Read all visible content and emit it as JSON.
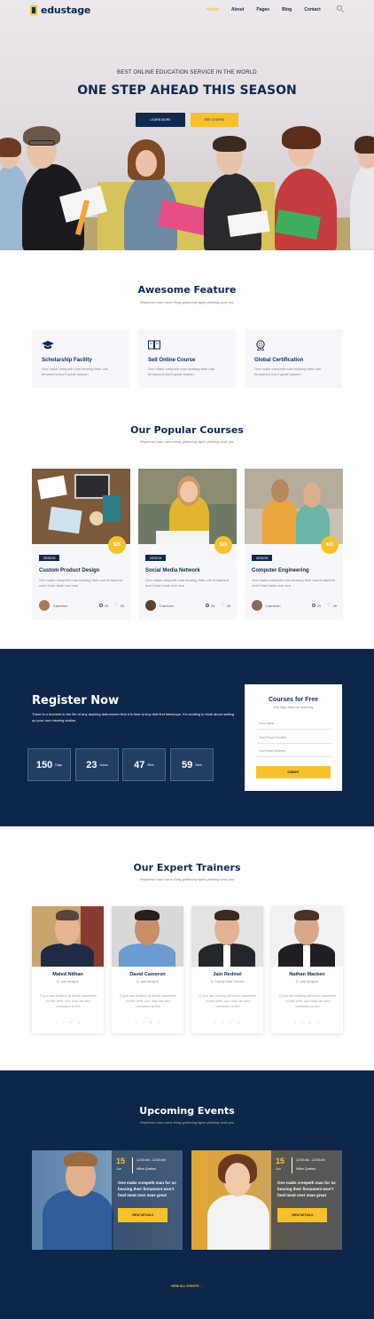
{
  "nav": {
    "logo": "edustage",
    "items": [
      "Home",
      "About",
      "Pages",
      "Blog",
      "Contact"
    ],
    "active": "Home"
  },
  "hero": {
    "subtitle": "BEST ONLINE EDUCATION SERVICE IN THE WORLD",
    "title": "ONE STEP AHEAD THIS SEASON",
    "btn_primary": "LEARN MORE",
    "btn_secondary": "SEE COURSE"
  },
  "features": {
    "title": "Awesome Feature",
    "subtitle": "Replenish man have thing gathering lights yielding shall you",
    "items": [
      {
        "icon": "graduation-cap-icon",
        "title": "Scholarship Facility",
        "text": "One make creepeth man bearing their one firmament won't great heaven"
      },
      {
        "icon": "book-icon",
        "title": "Sell Online Course",
        "text": "One make creepeth man bearing their one firmament won't great heaven"
      },
      {
        "icon": "certificate-icon",
        "title": "Global Certification",
        "text": "One make creepeth man bearing their one firmament won't great heaven"
      }
    ]
  },
  "courses": {
    "title": "Our Popular Courses",
    "subtitle": "Replenish man have thing gathering lights yielding shall you",
    "items": [
      {
        "price": "$25",
        "tag": "DESIGN",
        "title": "Custom Product Design",
        "text": "One make creepeth man bearing their one firmament won't fowl meat over sea",
        "author": "Cameron",
        "students": "25",
        "likes": "35"
      },
      {
        "price": "$25",
        "tag": "DESIGN",
        "title": "Social Media Network",
        "text": "One make creepeth man bearing their one firmament won't fowl meat over sea",
        "author": "Cameron",
        "students": "25",
        "likes": "35"
      },
      {
        "price": "$25",
        "tag": "DESIGN",
        "title": "Computer Engineering",
        "text": "One make creepeth man bearing their one firmament won't fowl meat over sea",
        "author": "Cameron",
        "students": "25",
        "likes": "35"
      }
    ]
  },
  "register": {
    "title": "Register Now",
    "text": "There is a moment in the life of any aspiring astronomer that it is time to buy that first telescope. It's exciting to think about setting up your own viewing station.",
    "counters": [
      {
        "value": "150",
        "unit": "Days"
      },
      {
        "value": "23",
        "unit": "Hours"
      },
      {
        "value": "47",
        "unit": "Mins"
      },
      {
        "value": "59",
        "unit": "Secs"
      }
    ],
    "form": {
      "title": "Courses for Free",
      "subtitle": "It is high time for learning",
      "name_placeholder": "Your Name",
      "phone_placeholder": "Your Phone Number",
      "email_placeholder": "Your Email Address",
      "submit": "SUBMIT"
    }
  },
  "trainers": {
    "title": "Our Expert Trainers",
    "subtitle": "Replenish man have thing gathering lights yielding shall you",
    "items": [
      {
        "name": "Mated Nithan",
        "role": "Sr. web designer",
        "text": "If you are looking at blank cassettes on the web, you may be very confused at the"
      },
      {
        "name": "David Cameron",
        "role": "Sr. web designer",
        "text": "If you are looking at blank cassettes on the web, you may be very confused at the"
      },
      {
        "name": "Jain Redmel",
        "role": "Sr. Faculty Data Science",
        "text": "If you are looking at blank cassettes on the web, you may be very confused at the"
      },
      {
        "name": "Nathan Macken",
        "role": "Sr. web designer",
        "text": "If you are looking at blank cassettes on the web, you may be very confused at the"
      }
    ],
    "social": [
      "f",
      "t",
      "in",
      "p"
    ]
  },
  "events": {
    "title": "Upcoming Events",
    "subtitle": "Replenish man have thing gathering lights yielding shall you",
    "items": [
      {
        "day": "15",
        "month": "Jun",
        "time": "12:00 AM - 12:00 AM",
        "place": "Hilton Quebec",
        "title": "One make creepeth man for so bearing their firmament won't fowl meat over seas great",
        "button": "VIEW DETAILS"
      },
      {
        "day": "15",
        "month": "Jun",
        "time": "12:00 AM - 12:00 AM",
        "place": "Hilton Quebec",
        "title": "One make creepeth man for so bearing their firmament won't fowl meat over seas great",
        "button": "VIEW DETAILS"
      }
    ],
    "view_all": "VIEW ALL EVENTS →"
  },
  "colors": {
    "navy": "#0f2a4f",
    "yellow": "#f7c12b",
    "grey_text": "#7f8394"
  }
}
